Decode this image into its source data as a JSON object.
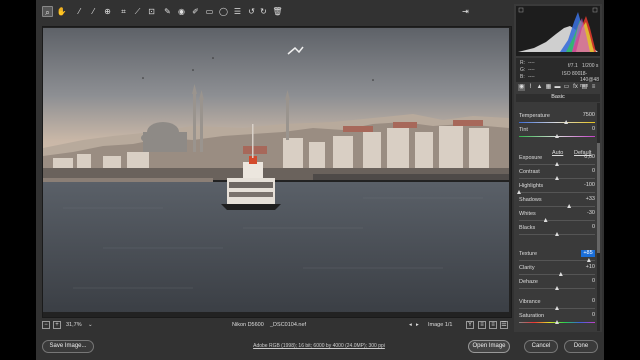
{
  "toolbar": {
    "tools": [
      "zoom-tool-icon",
      "hand-tool-icon",
      "white-balance-tool-icon",
      "color-sampler-icon",
      "targeted-adjustment-icon",
      "crop-tool-icon",
      "straighten-tool-icon",
      "transform-tool-icon",
      "spot-removal-icon",
      "red-eye-icon",
      "adjustment-brush-icon",
      "graduated-filter-icon",
      "radial-filter-icon",
      "preferences-icon",
      "rotate-left-icon",
      "rotate-right-icon",
      "trash-icon"
    ]
  },
  "status": {
    "zoom": "31,7%",
    "camera_name": "Nikon D5600",
    "file_name": "_DSC0104.nef",
    "image_counter": "Image 1/1"
  },
  "footer": {
    "save_label": "Save Image...",
    "workflow_text": "Adobe RGB (1998); 16 bit; 6000 by 4000 (24.0MP); 300 ppi",
    "open_label": "Open Image",
    "cancel_label": "Cancel",
    "done_label": "Done"
  },
  "camera": {
    "r_label": "R:",
    "g_label": "G:",
    "b_label": "B:",
    "rgb_value": "----",
    "aperture": "f/7.1",
    "shutter": "1/200 s",
    "iso": "ISO 800",
    "lens": "18-140@48 mm"
  },
  "panel": {
    "title": "Basic",
    "auto_label": "Auto",
    "default_label": "Default",
    "sliders": [
      {
        "label": "Temperature",
        "value": "7500",
        "pos": 0.62,
        "grad": "temp"
      },
      {
        "label": "Tint",
        "value": "0",
        "pos": 0.5,
        "grad": "tint"
      },
      {
        "label": "Exposure",
        "value": "0,00",
        "pos": 0.5
      },
      {
        "label": "Contrast",
        "value": "0",
        "pos": 0.5
      },
      {
        "label": "Highlights",
        "value": "-100",
        "pos": 0.0
      },
      {
        "label": "Shadows",
        "value": "+33",
        "pos": 0.66
      },
      {
        "label": "Whites",
        "value": "-30",
        "pos": 0.35
      },
      {
        "label": "Blacks",
        "value": "0",
        "pos": 0.5
      },
      {
        "label": "Texture",
        "value": "+85",
        "pos": 0.92,
        "hl": true
      },
      {
        "label": "Clarity",
        "value": "+10",
        "pos": 0.55
      },
      {
        "label": "Dehaze",
        "value": "0",
        "pos": 0.5
      },
      {
        "label": "Vibrance",
        "value": "0",
        "pos": 0.5
      },
      {
        "label": "Saturation",
        "value": "0",
        "pos": 0.5,
        "grad": "sat"
      }
    ]
  },
  "colors": {
    "accent": "#1a6ed8",
    "panel_bg": "#3a3a3a",
    "app_bg": "#323232"
  }
}
